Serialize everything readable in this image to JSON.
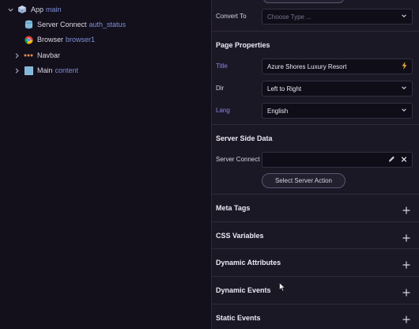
{
  "tree": {
    "items": [
      {
        "label": "App",
        "sub": "main",
        "icon": "cube-icon"
      },
      {
        "label": "Server Connect",
        "sub": "auth_status",
        "icon": "database-icon"
      },
      {
        "label": "Browser",
        "sub": "browser1",
        "icon": "chrome-icon"
      },
      {
        "label": "Navbar",
        "sub": "",
        "icon": "dots-icon"
      },
      {
        "label": "Main",
        "sub": "content",
        "icon": "square-icon"
      }
    ]
  },
  "props": {
    "convert_to": {
      "label": "Convert To",
      "placeholder": "Choose Type ..."
    },
    "page_properties": {
      "title": "Page Properties",
      "title_label": "Title",
      "title_value": "Azure Shores Luxury Resort",
      "dir_label": "Dir",
      "dir_value": "Left to Right",
      "lang_label": "Lang",
      "lang_value": "English"
    },
    "server_side": {
      "title": "Server Side Data",
      "connect_label": "Server Connect",
      "connect_value": "",
      "select_action": "Select Server Action"
    },
    "sections": [
      "Meta Tags",
      "CSS Variables",
      "Dynamic Attributes",
      "Dynamic Events",
      "Static Events"
    ]
  },
  "colors": {
    "accent": "#8a86e6",
    "sub": "#7f8fd6"
  }
}
